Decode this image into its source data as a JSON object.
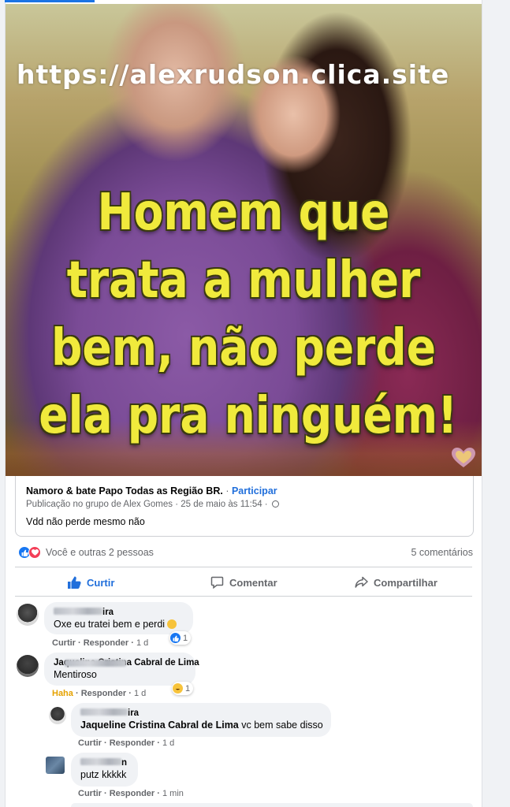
{
  "post": {
    "image": {
      "watermark": "https://alexrudson.clica.site",
      "quote_lines": [
        "Homem que",
        "trata a mulher",
        "bem, não perde",
        "ela pra ninguém!"
      ]
    },
    "shared": {
      "group_name": "Namoro & bate Papo Todas as Região BR.",
      "separator": "·",
      "join_label": "Participar",
      "publication": "Publicação no grupo de Alex Gomes · 25 de maio às 11:54 ·",
      "body": "Vdd não perde mesmo não"
    },
    "reactions_text": "Você e outras 2 pessoas",
    "comments_count": "5 comentários",
    "actions": {
      "like": "Curtir",
      "comment": "Comentar",
      "share": "Compartilhar"
    }
  },
  "comments": [
    {
      "name_visible": "ira",
      "text": "Oxe eu tratei bem e perdi",
      "actions": {
        "like": "Curtir",
        "reply": "Responder",
        "time": "1 d"
      },
      "reaction_count": "1"
    },
    {
      "name_visible": "Jaqueline Cristina Cabral de Lima",
      "text": "Mentiroso",
      "actions": {
        "like": "Haha",
        "reply": "Responder",
        "time": "1 d"
      },
      "reaction_count": "1"
    }
  ],
  "replies": [
    {
      "name_visible": "ira",
      "mention": "Jaqueline Cristina Cabral de Lima",
      "text": " vc bem sabe disso",
      "actions": {
        "like": "Curtir",
        "reply": "Responder",
        "time": "1 d"
      }
    },
    {
      "name_visible": "n",
      "text": "putz kkkkk",
      "actions": {
        "like": "Curtir",
        "reply": "Responder",
        "time": "1 min"
      }
    }
  ],
  "colors": {
    "accent": "#216fdb",
    "quote_yellow": "#f0ea3c",
    "bubble": "#f0f2f5",
    "haha": "#e5a200"
  }
}
